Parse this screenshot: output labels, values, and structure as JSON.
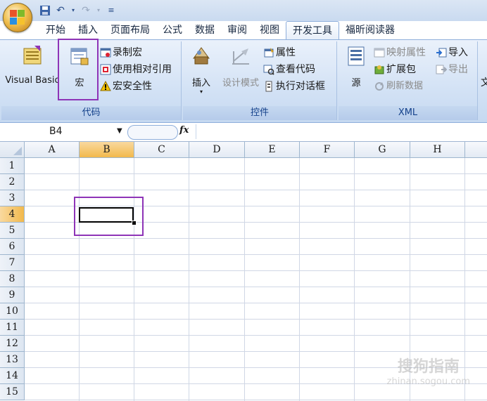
{
  "tabs": [
    "开始",
    "插入",
    "页面布局",
    "公式",
    "数据",
    "审阅",
    "视图",
    "开发工具",
    "福昕阅读器"
  ],
  "active_tab": "开发工具",
  "ribbon": {
    "code_group": {
      "label": "代码",
      "visual_basic": "Visual Basic",
      "macros": "宏",
      "record_macro": "录制宏",
      "use_relative_refs": "使用相对引用",
      "macro_security": "宏安全性"
    },
    "controls_group": {
      "label": "控件",
      "insert": "插入",
      "design_mode": "设计模式",
      "properties": "属性",
      "view_code": "查看代码",
      "run_dialog": "执行对话框"
    },
    "xml_group": {
      "label": "XML",
      "source": "源",
      "map_properties": "映射属性",
      "expansion_packs": "扩展包",
      "refresh_data": "刷新数据",
      "import": "导入",
      "export": "导出"
    }
  },
  "formula_bar": {
    "name_box": "B4",
    "fx": "fx",
    "formula": ""
  },
  "columns": [
    "A",
    "B",
    "C",
    "D",
    "E",
    "F",
    "G",
    "H"
  ],
  "rows": [
    "1",
    "2",
    "3",
    "4",
    "5",
    "6",
    "7",
    "8",
    "9",
    "10",
    "11",
    "12",
    "13",
    "14",
    "15"
  ],
  "selected_cell": "B4",
  "watermark": {
    "brand": "搜狗指南",
    "url": "zhinan.sogou.com"
  },
  "colors": {
    "highlight": "#8e34b7",
    "selected_header": "#f2b94c",
    "ribbon_text": "#15428b"
  }
}
